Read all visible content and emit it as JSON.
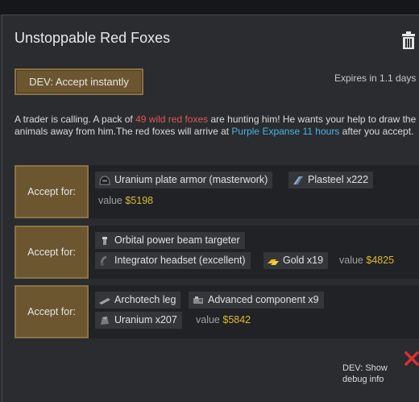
{
  "window": {
    "title": "Unstoppable Red Foxes",
    "expires": "Expires in 1.1 days",
    "dev_accept_label": "DEV: Accept instantly",
    "dev_debug_label": "DEV: Show debug info"
  },
  "description": {
    "part1": "A trader is calling. A pack of ",
    "highlight_count": "49 wild red foxes",
    "part2": " are hunting him! He wants your help to draw the animals away from him.The red foxes will arrive at ",
    "location": "Purple Expanse",
    "time": "11 hours",
    "part3": " after you accept."
  },
  "offers": [
    {
      "accept_label": "Accept for:",
      "items": [
        {
          "label": "Uranium plate armor (masterwork)",
          "icon": "helmet-icon"
        },
        {
          "label": "Plasteel x222",
          "icon": "plasteel-icon"
        }
      ],
      "value_label": "value",
      "value": "$5198"
    },
    {
      "accept_label": "Accept for:",
      "items": [
        {
          "label": "Orbital power beam targeter",
          "icon": "targeter-icon"
        },
        {
          "label": "Integrator headset (excellent)",
          "icon": "headset-icon"
        },
        {
          "label": "Gold x19",
          "icon": "gold-icon"
        }
      ],
      "value_label": "value",
      "value": "$4825"
    },
    {
      "accept_label": "Accept for:",
      "items": [
        {
          "label": "Archotech leg",
          "icon": "leg-icon"
        },
        {
          "label": "Advanced component x9",
          "icon": "component-icon"
        },
        {
          "label": "Uranium x207",
          "icon": "uranium-icon"
        }
      ],
      "value_label": "value",
      "value": "$5842"
    }
  ],
  "colors": {
    "threat_red": "#e05555",
    "place_blue": "#4ab4e6",
    "value_gold": "#e0b82e",
    "button_brown": "#6b5630",
    "close_red": "#d93030"
  }
}
